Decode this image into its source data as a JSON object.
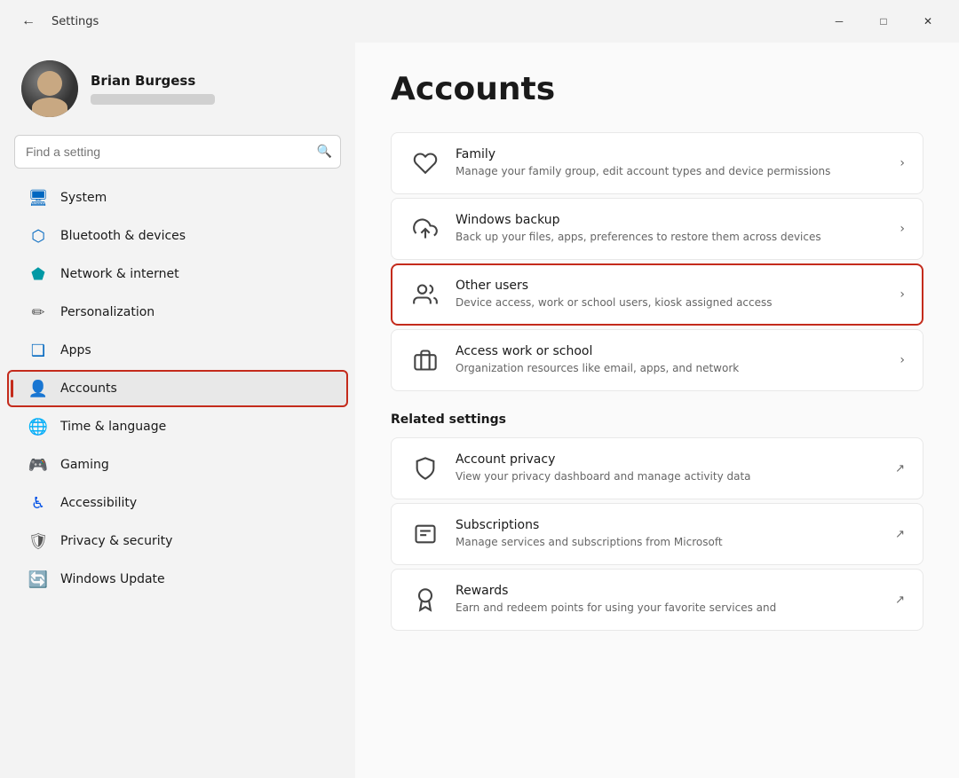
{
  "window": {
    "title": "Settings",
    "controls": {
      "minimize": "─",
      "maximize": "□",
      "close": "✕"
    }
  },
  "user": {
    "name": "Brian Burgess",
    "email_placeholder": ""
  },
  "search": {
    "placeholder": "Find a setting"
  },
  "nav": {
    "items": [
      {
        "id": "system",
        "label": "System",
        "icon": "🖥",
        "iconColor": "icon-blue"
      },
      {
        "id": "bluetooth",
        "label": "Bluetooth & devices",
        "icon": "⬡",
        "iconColor": "icon-blue"
      },
      {
        "id": "network",
        "label": "Network & internet",
        "icon": "⬟",
        "iconColor": "icon-teal"
      },
      {
        "id": "personalization",
        "label": "Personalization",
        "icon": "✏",
        "iconColor": "icon-gray"
      },
      {
        "id": "apps",
        "label": "Apps",
        "icon": "❑",
        "iconColor": "icon-blue"
      },
      {
        "id": "accounts",
        "label": "Accounts",
        "icon": "👤",
        "iconColor": "icon-blue",
        "active": true
      },
      {
        "id": "time-language",
        "label": "Time & language",
        "icon": "🌐",
        "iconColor": "icon-cyan"
      },
      {
        "id": "gaming",
        "label": "Gaming",
        "icon": "🎮",
        "iconColor": "icon-gray"
      },
      {
        "id": "accessibility",
        "label": "Accessibility",
        "icon": "♿",
        "iconColor": "icon-darkblue"
      },
      {
        "id": "privacy-security",
        "label": "Privacy & security",
        "icon": "🛡",
        "iconColor": "icon-gray"
      },
      {
        "id": "windows-update",
        "label": "Windows Update",
        "icon": "🔄",
        "iconColor": "icon-blue"
      }
    ]
  },
  "content": {
    "page_title": "Accounts",
    "cards": [
      {
        "id": "family",
        "title": "Family",
        "description": "Manage your family group, edit account types and device permissions",
        "icon": "♡",
        "highlighted": false
      },
      {
        "id": "windows-backup",
        "title": "Windows backup",
        "description": "Back up your files, apps, preferences to restore them across devices",
        "icon": "⬆",
        "highlighted": false
      },
      {
        "id": "other-users",
        "title": "Other users",
        "description": "Device access, work or school users, kiosk assigned access",
        "icon": "👥",
        "highlighted": true
      },
      {
        "id": "access-work-school",
        "title": "Access work or school",
        "description": "Organization resources like email, apps, and network",
        "icon": "💼",
        "highlighted": false
      }
    ],
    "related_settings_label": "Related settings",
    "related_cards": [
      {
        "id": "account-privacy",
        "title": "Account privacy",
        "description": "View your privacy dashboard and manage activity data",
        "icon": "🛡",
        "external": true
      },
      {
        "id": "subscriptions",
        "title": "Subscriptions",
        "description": "Manage services and subscriptions from Microsoft",
        "icon": "📋",
        "external": true
      },
      {
        "id": "rewards",
        "title": "Rewards",
        "description": "Earn and redeem points for using your favorite services and",
        "icon": "🏆",
        "external": true
      }
    ]
  }
}
